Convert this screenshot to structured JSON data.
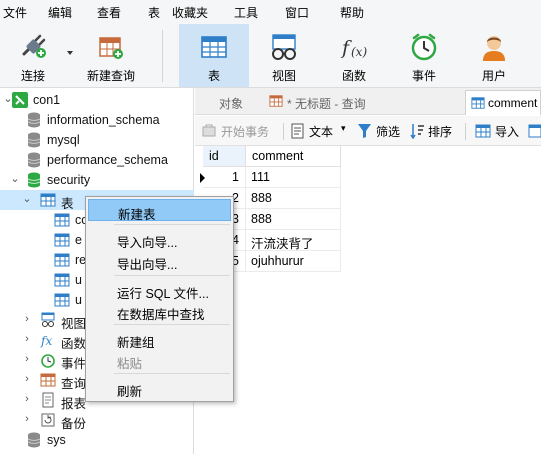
{
  "menubar": {
    "items": [
      "文件",
      "编辑",
      "查看",
      "表",
      "收藏夹",
      "工具",
      "窗口",
      "帮助"
    ]
  },
  "toolbar": {
    "connect_label": "连接",
    "new_query_label": "新建查询",
    "table_label": "表",
    "view_label": "视图",
    "function_label": "函数",
    "event_label": "事件",
    "user_label": "用户"
  },
  "tree": {
    "connection": "con1",
    "databases": [
      "information_schema",
      "mysql",
      "performance_schema",
      "security"
    ],
    "tables_label": "表",
    "table_items": [
      "co",
      "e",
      "re",
      "u",
      "u"
    ],
    "views_label": "视图",
    "functions_label": "函数",
    "events_label": "事件",
    "queries_label": "查询",
    "reports_label": "报表",
    "backup_label": "备份",
    "sys_label": "sys"
  },
  "tabs": {
    "objects": "对象",
    "untitled_query": "* 无标题 - 查询",
    "comment_tab": "comment"
  },
  "subtoolbar": {
    "begin_transaction": "开始事务",
    "text": "文本",
    "filter": "筛选",
    "sort": "排序",
    "import": "导入"
  },
  "grid": {
    "columns": [
      "id",
      "comment"
    ],
    "rows": [
      {
        "id": "1",
        "comment": "111"
      },
      {
        "id": "2",
        "comment": "888"
      },
      {
        "id": "3",
        "comment": "888"
      },
      {
        "id": "4",
        "comment": "汗流浃背了"
      },
      {
        "id": "5",
        "comment": "ojuhhurur"
      }
    ]
  },
  "context_menu": {
    "new_table": "新建表",
    "import_wizard": "导入向导...",
    "export_wizard": "导出向导...",
    "run_sql": "运行 SQL 文件...",
    "find_in_db": "在数据库中查找",
    "new_group": "新建组",
    "paste": "粘贴",
    "refresh": "刷新"
  },
  "colors": {
    "accent": "#cfe3f6",
    "selection": "#cce8ff",
    "menu_highlight": "#91c9f7",
    "connection_green": "#2ea843"
  }
}
